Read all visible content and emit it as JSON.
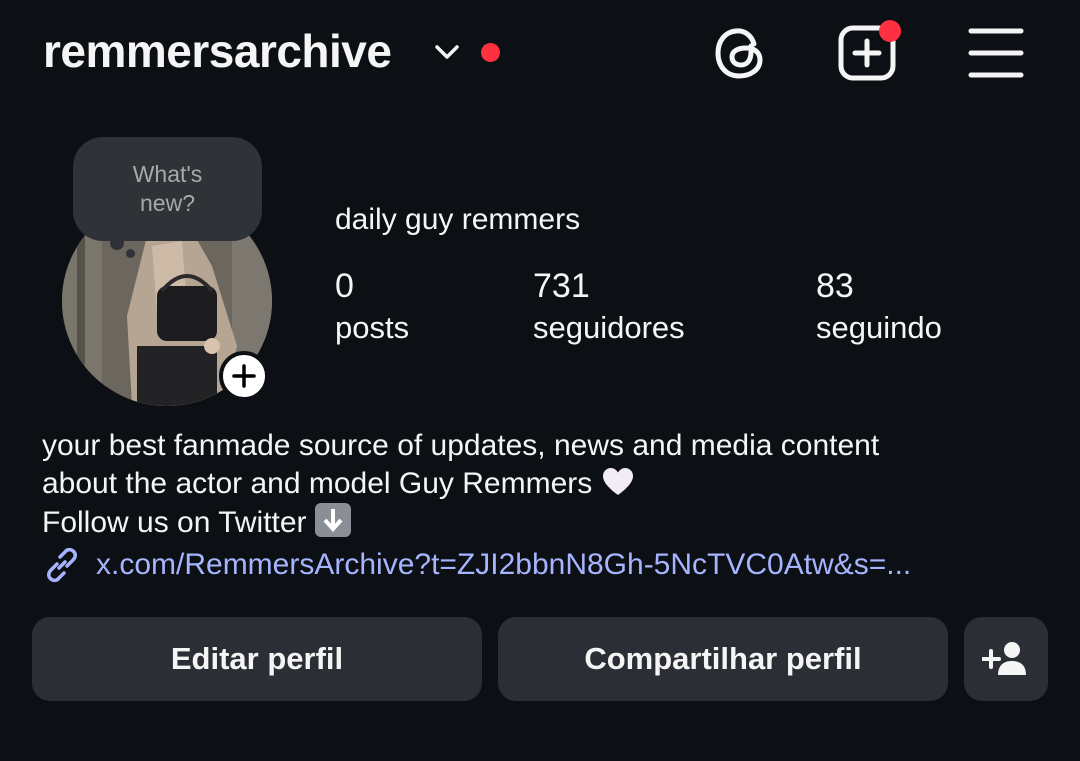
{
  "header": {
    "username": "remmersarchive"
  },
  "story_bubble": {
    "line1": "What's",
    "line2": "new?"
  },
  "profile": {
    "display_name": "daily guy remmers",
    "stats": [
      {
        "value": "0",
        "label": "posts"
      },
      {
        "value": "731",
        "label": "seguidores"
      },
      {
        "value": "83",
        "label": "seguindo"
      }
    ]
  },
  "bio": {
    "line1": "your best fanmade source of updates, news and media content",
    "line2": "about the actor and model Guy Remmers",
    "line3": "Follow us on Twitter",
    "link": "x.com/RemmersArchive?t=ZJI2bbnN8Gh-5NcTVC0Atw&s=..."
  },
  "buttons": {
    "edit": "Editar perfil",
    "share": "Compartilhar perfil"
  },
  "colors": {
    "background": "#0c1014",
    "button": "#2b2f35",
    "link": "#a6b4ff",
    "notification": "#ff3040"
  },
  "icons": [
    "chevron-down-icon",
    "threads-icon",
    "create-post-icon",
    "menu-icon",
    "plus-icon",
    "link-icon",
    "add-user-icon",
    "white-heart-emoji",
    "down-arrow-emoji"
  ]
}
